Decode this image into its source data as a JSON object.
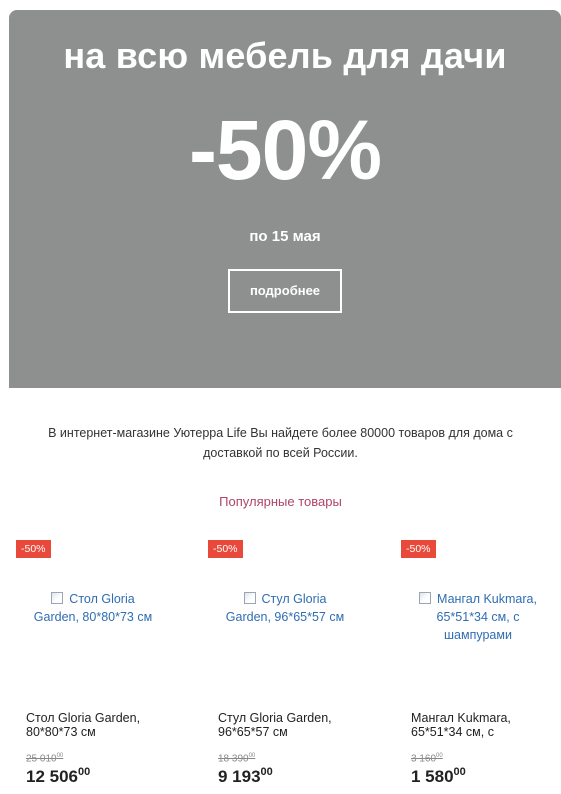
{
  "hero": {
    "title": "на всю мебель для дачи",
    "discount": "-50%",
    "date": "по 15 мая",
    "button_label": "подробнее",
    "background_color": "#8e8f8f"
  },
  "intro": {
    "text": "В интернет-магазине Уютерра Life Вы найдете более 80000 товаров для дома с доставкой по всей России."
  },
  "section": {
    "title": "Популярные товары"
  },
  "products": [
    {
      "badge": "-50%",
      "image_alt": "Стол Gloria Garden, 80*80*73 см",
      "name": "Стол Gloria Garden, 80*80*73 см",
      "old_price": "25 010",
      "old_price_kop": "00",
      "new_price": "12 506",
      "new_price_kop": "00"
    },
    {
      "badge": "-50%",
      "image_alt": "Стул Gloria Garden, 96*65*57 см",
      "name": "Стул Gloria Garden, 96*65*57 см",
      "old_price": "18 390",
      "old_price_kop": "00",
      "new_price": "9 193",
      "new_price_kop": "00"
    },
    {
      "badge": "-50%",
      "image_alt": "Мангал Kukmara, 65*51*34 см, с шампурами",
      "name": "Мангал Kukmara, 65*51*34 см, с",
      "old_price": "3 160",
      "old_price_kop": "00",
      "new_price": "1 580",
      "new_price_kop": "00"
    }
  ],
  "colors": {
    "badge": "#e8493a",
    "section_title": "#b0456a",
    "link": "#2f6db3"
  }
}
